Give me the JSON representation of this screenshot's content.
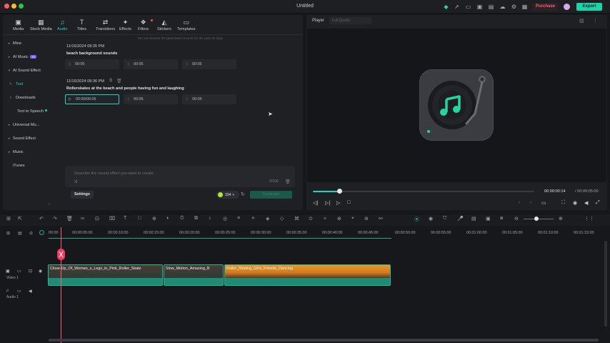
{
  "window": {
    "title": "Untitled",
    "purchase_label": "Purchase",
    "export_label": "Export"
  },
  "media_tabs": [
    {
      "label": "Media",
      "icon": "media-icon"
    },
    {
      "label": "Stock Media",
      "icon": "stock-media-icon"
    },
    {
      "label": "Audio",
      "icon": "music-note-icon",
      "active": true
    },
    {
      "label": "Titles",
      "icon": "titles-icon"
    },
    {
      "label": "Transitions",
      "icon": "transitions-icon"
    },
    {
      "label": "Effects",
      "icon": "effects-icon"
    },
    {
      "label": "Filters",
      "icon": "filters-icon"
    },
    {
      "label": "Stickers",
      "icon": "stickers-icon"
    },
    {
      "label": "Templates",
      "icon": "templates-icon"
    }
  ],
  "sidebar": {
    "items": [
      {
        "label": "Mine"
      },
      {
        "label": "AI Music",
        "tag": "AI"
      },
      {
        "label": "AI Sound Effect"
      },
      {
        "label": "Tool",
        "active": true
      },
      {
        "label": "Downloads"
      },
      {
        "label": "Text to Speech"
      },
      {
        "label": "Universal Mu..."
      },
      {
        "label": "Sound Effect"
      },
      {
        "label": "Music"
      },
      {
        "label": "iTunes"
      }
    ]
  },
  "generations": {
    "notice": "You can browse the generated records for the past 30 days",
    "groups": [
      {
        "timestamp": "11/16/2024 08:35 PM",
        "prompt": "beach background sounds",
        "clips": [
          "00:05",
          "00:05",
          "00:05"
        ]
      },
      {
        "timestamp": "11/16/2024 08:36 PM",
        "prompt": "Rollerskates at the beach and people having fun and laughing",
        "clips": [
          "00:00/00:05",
          "00:05",
          "00:05"
        ]
      }
    ]
  },
  "prompt_input": {
    "placeholder": "Describe the sound effect you want to create.",
    "char_count": "0/100"
  },
  "settings_label": "Settings",
  "credits": "334",
  "generate_label": "Generate",
  "player": {
    "label": "Player",
    "quality": "Full Quality",
    "current_time": "00:00:00:14",
    "total_time": "/ 00:00:05:00",
    "progress": 0.12
  },
  "timeline": {
    "ticks": [
      "00:00",
      "00:00:05:00",
      "00:00:10:00",
      "00:00:15:00",
      "00:00:20:00",
      "00:00:25:00",
      "00:00:30:00",
      "00:00:35:00",
      "00:00:40:00",
      "00:00:45:00",
      "00:00:50:00",
      "00:00:55:00",
      "00:01:00:00",
      "00:01:05:00",
      "00:01:10:00",
      "00:01:15:00"
    ],
    "tracks": {
      "video": "Video 1",
      "audio": "Audio 1"
    },
    "clips": [
      {
        "label": "Close-Up_Of_Woman_s_Legs_in_Pink_Roller_Skate"
      },
      {
        "label": "Slow_Motion_Amazing_B"
      },
      {
        "label": "Roller_Skating_Girls_Friends_Dancing"
      }
    ]
  },
  "colors": {
    "accent": "#1fd3c5",
    "export": "#1cd4a8",
    "playhead": "#ff5c7a",
    "purchase": "#ff5c7a"
  }
}
